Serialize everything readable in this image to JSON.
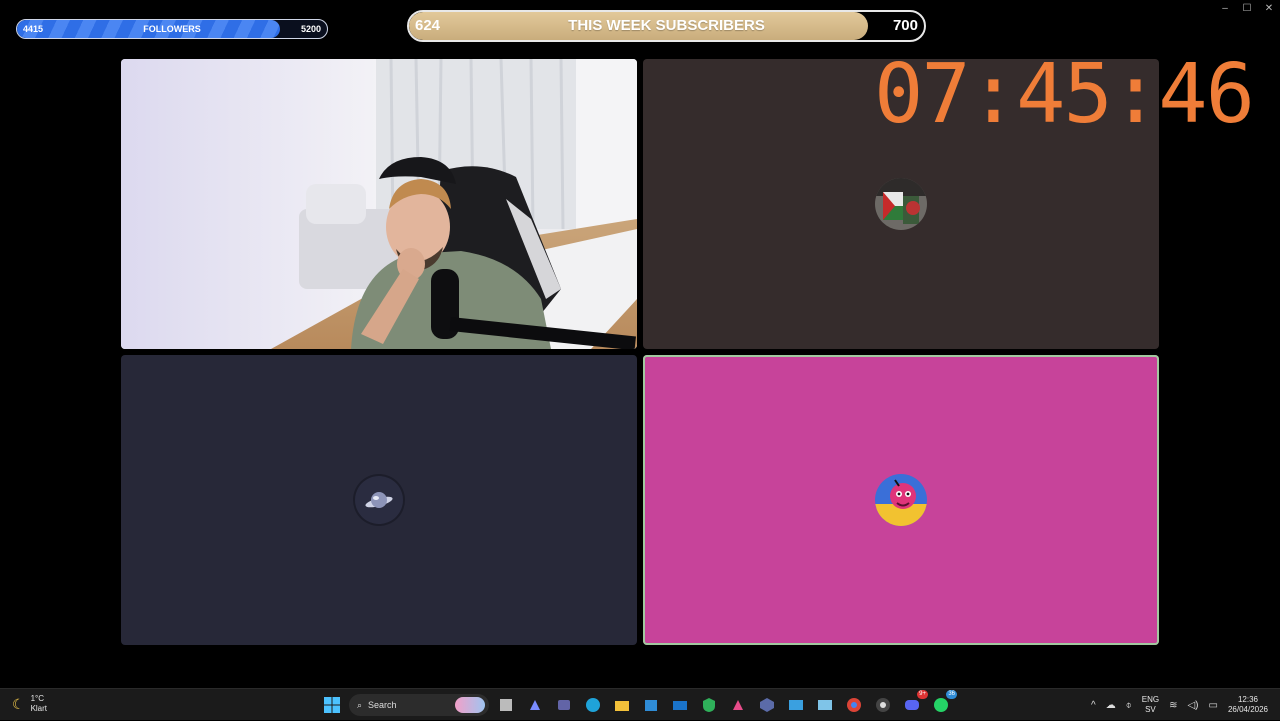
{
  "window_controls": {
    "minimize": "–",
    "maximize": "☐",
    "close": "✕"
  },
  "followers_bar": {
    "label": "FOLLOWERS",
    "current": "4415",
    "goal": "5200",
    "progress": 0.849,
    "color": "#2f6ee6"
  },
  "subscribers_bar": {
    "label": "THIS WEEK SUBSCRIBERS",
    "current": "624",
    "goal": "700",
    "progress": 0.891,
    "color": "#d6bc8c"
  },
  "clock": "07:45:46",
  "tiles": [
    {
      "name": "webcam",
      "bg": "#e8e6ee"
    },
    {
      "name": "participant-2",
      "bg": "#352c2c",
      "avatar": "flag-avatar"
    },
    {
      "name": "participant-3",
      "bg": "#272838",
      "avatar": "planet-avatar"
    },
    {
      "name": "participant-4",
      "bg": "#c7439a",
      "avatar": "cartoon-avatar",
      "speaking": true
    }
  ],
  "taskbar": {
    "weather": {
      "temp": "1°C",
      "condition": "Klart",
      "icon": "moon-icon"
    },
    "search_placeholder": "Search",
    "apps": [
      "windows-start-icon",
      "copilot-icon",
      "files-icon",
      "copilot-app-icon",
      "teams-icon",
      "edge-icon",
      "file-explorer-icon",
      "store-icon",
      "mail-icon",
      "vpn-icon",
      "m365-icon",
      "box-icon",
      "photos-icon",
      "remote-icon",
      "chrome-icon",
      "obs-icon",
      "discord-icon",
      "whatsapp-icon"
    ],
    "badges": {
      "discord": "9+",
      "whatsapp": "36"
    },
    "tray": {
      "lang": "ENG",
      "region": "SV",
      "time": "12:36",
      "date": "26/04/2026"
    }
  }
}
